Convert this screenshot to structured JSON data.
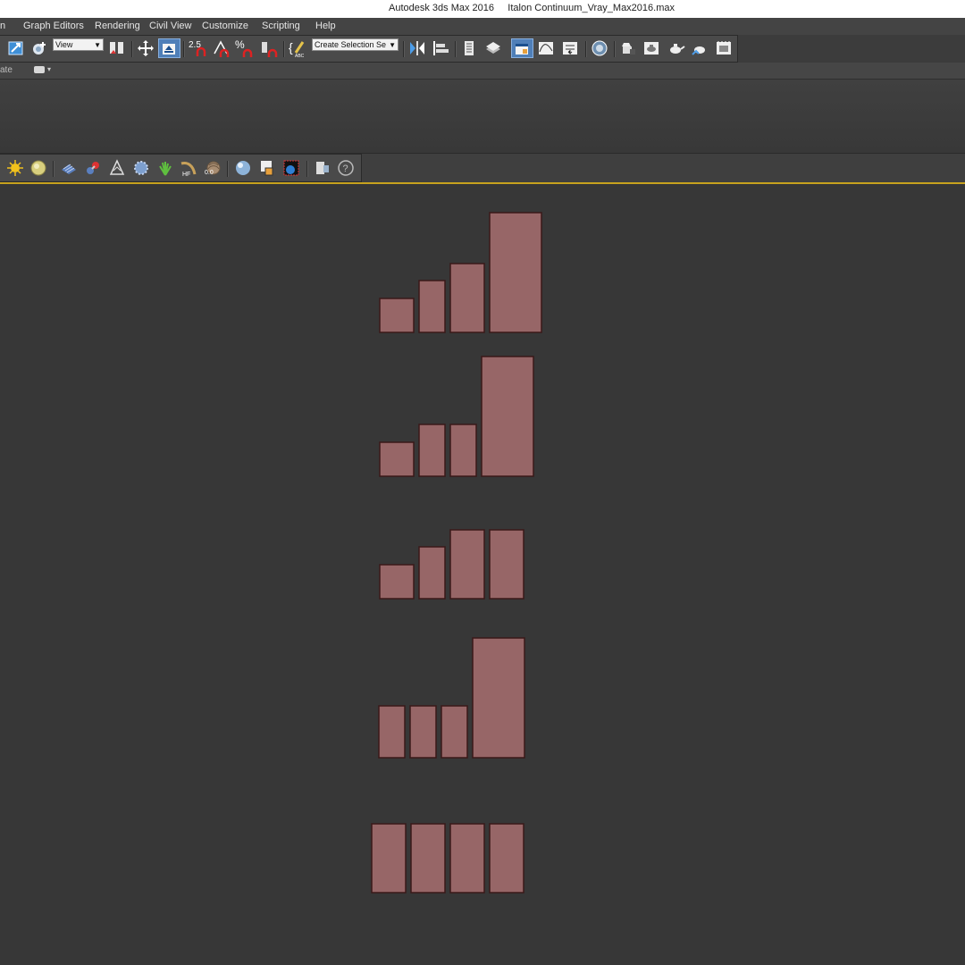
{
  "window": {
    "title": "Autodesk 3ds Max 2016     Italon Continuum_Vray_Max2016.max"
  },
  "menu": {
    "items": [
      {
        "label": "n"
      },
      {
        "label": "Graph Editors"
      },
      {
        "label": "Rendering"
      },
      {
        "label": "Civil View"
      },
      {
        "label": "Customize"
      },
      {
        "label": "Scripting"
      },
      {
        "label": "Help"
      }
    ]
  },
  "toolbar": {
    "ref_coord": "View",
    "snap_angle": "2.5",
    "snap_percent": "%",
    "selection_set_placeholder": "Create Selection Se",
    "icons": [
      "select-scale-icon",
      "select-object-icon",
      "ref-coord-icon",
      "mirror-use-pivot-icon",
      "select-move-icon",
      "place-icon",
      "snap-2-5d-icon",
      "angle-snap-icon",
      "percent-snap-icon",
      "spinner-snap-icon",
      "edit-named-sets-icon",
      "mirror-icon",
      "align-icon",
      "layer-manager-icon",
      "scene-explorer-icon",
      "toggle-ribbon-icon",
      "curve-editor-icon",
      "schematic-view-icon",
      "material-editor-icon",
      "render-setup-icon",
      "rendered-frame-icon",
      "render-teapot-icon",
      "render-iterative-icon",
      "render-environment-icon"
    ]
  },
  "subbar": {
    "label": "ate"
  },
  "vray_toolbar": {
    "icons": [
      "vray-sun-icon",
      "vray-light-sphere-icon",
      "vray-plane-icon",
      "vray-fur-icon",
      "vray-proxy-icon",
      "vray-displacement-icon",
      "vray-grass-icon",
      "vray-hair-icon",
      "vray-sphere-icon",
      "vray-material-icon",
      "vray-render-region-icon",
      "vray-frame-buffer-icon",
      "vray-toggle-icon",
      "help-icon"
    ]
  },
  "colors": {
    "tile_fill": "#976667",
    "tile_stroke": "#3a1818",
    "viewport_bg": "#373737",
    "active_border": "#c7a21e"
  },
  "scene": {
    "groups": [
      {
        "name": "tile-group-1",
        "tiles": [
          {
            "w": 38,
            "h": 38
          },
          {
            "w": 29,
            "h": 58
          },
          {
            "w": 38,
            "h": 77
          },
          {
            "w": 58,
            "h": 134
          }
        ]
      },
      {
        "name": "tile-group-2",
        "tiles": [
          {
            "w": 38,
            "h": 38
          },
          {
            "w": 29,
            "h": 58
          },
          {
            "w": 29,
            "h": 58
          },
          {
            "w": 58,
            "h": 134
          }
        ]
      },
      {
        "name": "tile-group-3",
        "tiles": [
          {
            "w": 38,
            "h": 38
          },
          {
            "w": 29,
            "h": 58
          },
          {
            "w": 38,
            "h": 77
          },
          {
            "w": 38,
            "h": 77
          }
        ]
      },
      {
        "name": "tile-group-4",
        "tiles": [
          {
            "w": 29,
            "h": 58
          },
          {
            "w": 29,
            "h": 58
          },
          {
            "w": 29,
            "h": 58
          },
          {
            "w": 58,
            "h": 134
          }
        ]
      },
      {
        "name": "tile-group-5",
        "tiles": [
          {
            "w": 38,
            "h": 77
          },
          {
            "w": 38,
            "h": 77
          },
          {
            "w": 38,
            "h": 77
          },
          {
            "w": 38,
            "h": 77
          }
        ]
      }
    ]
  }
}
